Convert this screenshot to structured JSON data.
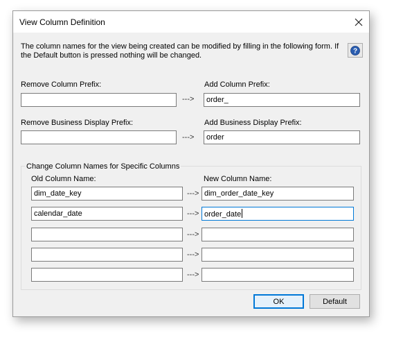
{
  "window": {
    "title": "View Column Definition",
    "intro": "The column names for the view being created can be modified by filling in the following form. If the Default button is pressed nothing will be changed."
  },
  "prefix": {
    "remove_column_label": "Remove Column Prefix:",
    "add_column_label": "Add Column Prefix:",
    "remove_column_value": "",
    "add_column_value": "order_",
    "remove_business_label": "Remove Business Display Prefix:",
    "add_business_label": "Add Business Display Prefix:",
    "remove_business_value": "",
    "add_business_value": "order",
    "arrow": "--->"
  },
  "specific": {
    "group_title": "Change Column Names for Specific Columns",
    "old_header": "Old Column Name:",
    "new_header": "New Column Name:",
    "rows": [
      {
        "old": "dim_date_key",
        "new": "dim_order_date_key",
        "arrow": "--->"
      },
      {
        "old": "calendar_date",
        "new": "order_date",
        "arrow": "--->"
      },
      {
        "old": "",
        "new": "",
        "arrow": "--->"
      },
      {
        "old": "",
        "new": "",
        "arrow": "--->"
      },
      {
        "old": "",
        "new": "",
        "arrow": "--->"
      }
    ]
  },
  "buttons": {
    "ok": "OK",
    "default": "Default"
  },
  "icons": {
    "close": "close-icon",
    "help": "help-icon"
  },
  "colors": {
    "accent": "#0078d7",
    "help_icon": "#2a5db0"
  }
}
